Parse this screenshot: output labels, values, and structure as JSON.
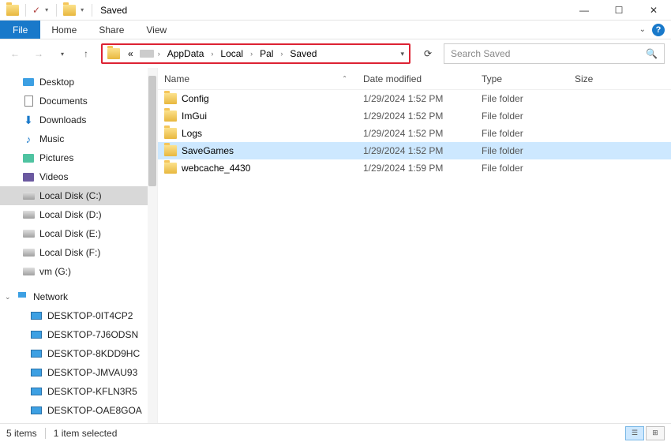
{
  "window": {
    "title": "Saved",
    "qat_check": "✓"
  },
  "ribbon": {
    "file": "File",
    "tabs": [
      "Home",
      "Share",
      "View"
    ]
  },
  "nav": {
    "back": "←",
    "fwd": "→",
    "up": "↑",
    "breadcrumbs_prefix": "«",
    "breadcrumbs": [
      "AppData",
      "Local",
      "Pal",
      "Saved"
    ],
    "refresh": "⟳",
    "search_placeholder": "Search Saved"
  },
  "tree": [
    {
      "icon": "desktop",
      "label": "Desktop",
      "level": 0
    },
    {
      "icon": "doc",
      "label": "Documents",
      "level": 0
    },
    {
      "icon": "down",
      "label": "Downloads",
      "level": 0
    },
    {
      "icon": "music",
      "label": "Music",
      "level": 0
    },
    {
      "icon": "pic",
      "label": "Pictures",
      "level": 0
    },
    {
      "icon": "vid",
      "label": "Videos",
      "level": 0
    },
    {
      "icon": "disk",
      "label": "Local Disk (C:)",
      "level": 0,
      "selected": true
    },
    {
      "icon": "disk",
      "label": "Local Disk (D:)",
      "level": 0
    },
    {
      "icon": "disk",
      "label": "Local Disk (E:)",
      "level": 0
    },
    {
      "icon": "disk",
      "label": "Local Disk (F:)",
      "level": 0
    },
    {
      "icon": "disk",
      "label": "vm (G:)",
      "level": 0
    },
    {
      "icon": "net",
      "label": "Network",
      "level": -1,
      "expandable": true
    },
    {
      "icon": "mon",
      "label": "DESKTOP-0IT4CP2",
      "level": 1
    },
    {
      "icon": "mon",
      "label": "DESKTOP-7J6ODSN",
      "level": 1
    },
    {
      "icon": "mon",
      "label": "DESKTOP-8KDD9HC",
      "level": 1
    },
    {
      "icon": "mon",
      "label": "DESKTOP-JMVAU93",
      "level": 1
    },
    {
      "icon": "mon",
      "label": "DESKTOP-KFLN3R5",
      "level": 1
    },
    {
      "icon": "mon",
      "label": "DESKTOP-OAE8GOA",
      "level": 1
    }
  ],
  "columns": {
    "name": "Name",
    "date": "Date modified",
    "type": "Type",
    "size": "Size"
  },
  "rows": [
    {
      "name": "Config",
      "date": "1/29/2024 1:52 PM",
      "type": "File folder",
      "size": ""
    },
    {
      "name": "ImGui",
      "date": "1/29/2024 1:52 PM",
      "type": "File folder",
      "size": ""
    },
    {
      "name": "Logs",
      "date": "1/29/2024 1:52 PM",
      "type": "File folder",
      "size": ""
    },
    {
      "name": "SaveGames",
      "date": "1/29/2024 1:52 PM",
      "type": "File folder",
      "size": "",
      "selected": true
    },
    {
      "name": "webcache_4430",
      "date": "1/29/2024 1:59 PM",
      "type": "File folder",
      "size": ""
    }
  ],
  "status": {
    "count": "5 items",
    "selected": "1 item selected"
  }
}
